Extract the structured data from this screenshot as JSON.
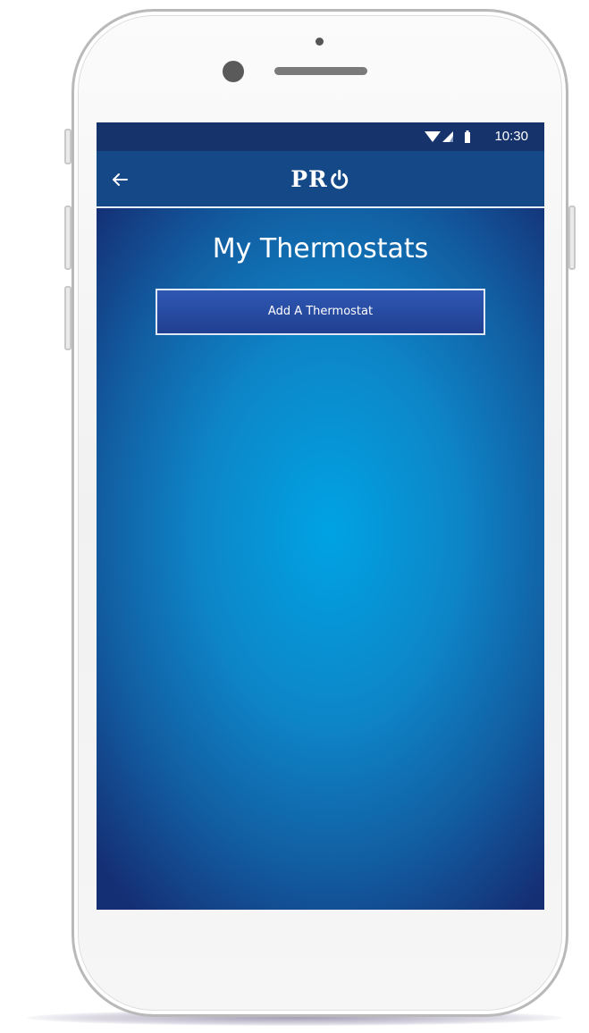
{
  "status_bar": {
    "time": "10:30",
    "icons": [
      "wifi-icon",
      "signal-icon",
      "battery-icon"
    ]
  },
  "app_bar": {
    "back_icon": "back-arrow-icon",
    "logo_text": "PR",
    "logo_icon": "power-icon"
  },
  "main": {
    "title": "My Thermostats",
    "add_button_label": "Add A Thermostat"
  },
  "colors": {
    "status_bar_bg": "#16336c",
    "app_bar_bg": "#144886",
    "screen_center": "#00a3e3",
    "screen_edge": "#152f75",
    "button_bg": "#2a4ea6"
  }
}
